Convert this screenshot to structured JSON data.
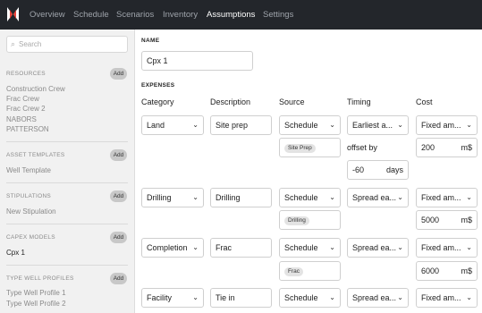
{
  "nav": {
    "tabs": [
      {
        "label": "Overview"
      },
      {
        "label": "Schedule"
      },
      {
        "label": "Scenarios"
      },
      {
        "label": "Inventory"
      },
      {
        "label": "Assumptions"
      },
      {
        "label": "Settings"
      }
    ],
    "active_tab": "Assumptions"
  },
  "sidebar": {
    "search_placeholder": "Search",
    "add_label": "Add",
    "sections": [
      {
        "title": "RESOURCES",
        "items": [
          "Construction Crew",
          "Frac Crew",
          "Frac Crew 2",
          "NABORS",
          "PATTERSON"
        ]
      },
      {
        "title": "ASSET TEMPLATES",
        "items": [
          "Well Template"
        ]
      },
      {
        "title": "STIPULATIONS",
        "items": [
          "New Stipulation"
        ]
      },
      {
        "title": "CAPEX MODELS",
        "items": [
          "Cpx 1"
        ]
      },
      {
        "title": "TYPE WELL PROFILES",
        "items": [
          "Type Well Profile 1",
          "Type Well Profile 2"
        ]
      }
    ],
    "selected_item": "Cpx 1"
  },
  "main": {
    "name_label": "NAME",
    "name_value": "Cpx 1",
    "expenses_label": "EXPENSES",
    "columns": [
      "Category",
      "Description",
      "Source",
      "Timing",
      "Cost"
    ],
    "rows": [
      {
        "category": "Land",
        "description": "Site prep",
        "source": "Schedule",
        "chip": "Site Prep",
        "timing": "Earliest a...",
        "offset_label": "offset by",
        "offset_value": "-60",
        "offset_unit": "days",
        "cost_type": "Fixed am...",
        "cost_value": "200",
        "cost_unit": "m$"
      },
      {
        "category": "Drilling",
        "description": "Drilling",
        "source": "Schedule",
        "chip": "Drilling",
        "timing": "Spread ea...",
        "cost_type": "Fixed am...",
        "cost_value": "5000",
        "cost_unit": "m$"
      },
      {
        "category": "Completion",
        "description": "Frac",
        "source": "Schedule",
        "chip": "Frac",
        "timing": "Spread ea...",
        "cost_type": "Fixed am...",
        "cost_value": "6000",
        "cost_unit": "m$"
      },
      {
        "category": "Facility",
        "description": "Tie in",
        "source": "Schedule",
        "timing": "Spread ea...",
        "cost_type": "Fixed am..."
      }
    ]
  },
  "colors": {
    "topbar": "#23262b",
    "sidebar": "#f1f1f1",
    "accent_logo": "#e8433a"
  },
  "icons": {
    "logo": "logo-icon",
    "search": "search-icon",
    "chevron": "chevron-down-icon"
  }
}
